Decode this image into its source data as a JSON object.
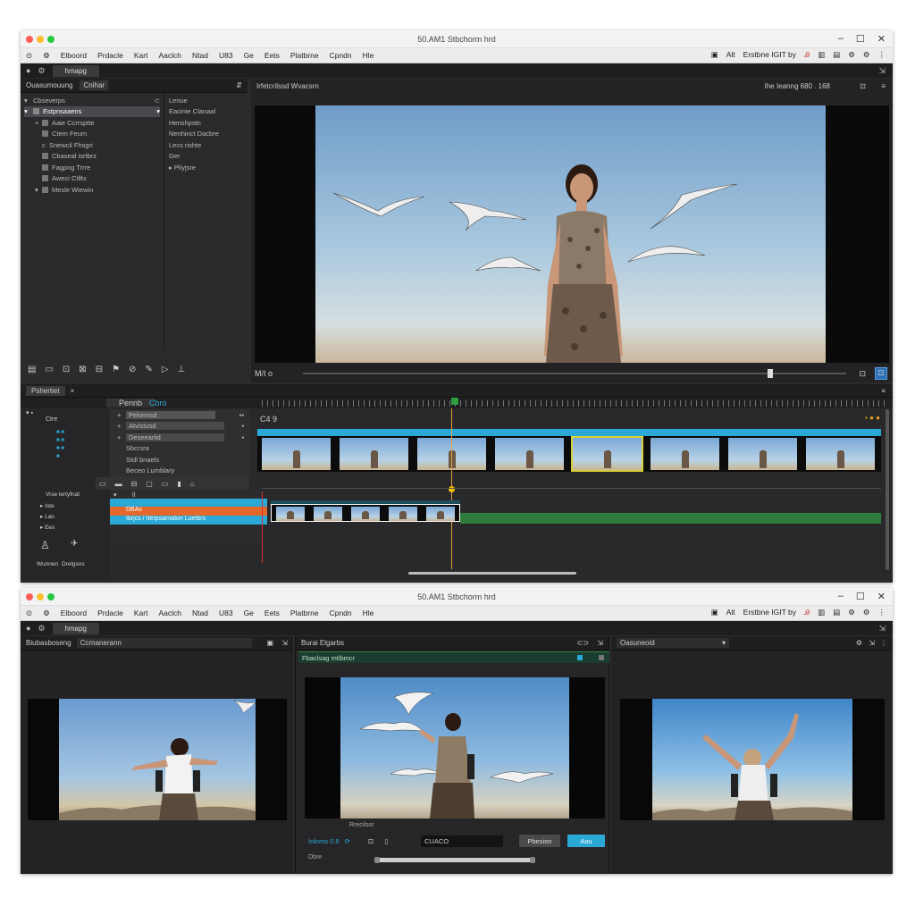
{
  "window1": {
    "title": "50.AM1 Stbchorm hrd",
    "menu": [
      "Elboord",
      "Prdacle",
      "Kart",
      "Aaclch",
      "Ntad",
      "U83",
      "Ge",
      "Eets",
      "Platbrne",
      "Cpndn",
      "Hle"
    ],
    "menu_right": [
      "Alt",
      "Erstbne IGIT by",
      "Ri"
    ],
    "tab": "hmapg",
    "project_panel": {
      "header_left": "Ouasumouung",
      "header_mid": "Cnihar",
      "items": [
        {
          "label": "Cbseverps",
          "selected": false
        },
        {
          "label": "Estpnsaaens",
          "selected": true
        },
        {
          "label": "Aaie Ccrrsptte",
          "selected": false
        },
        {
          "label": "Ctem Feum",
          "selected": false
        },
        {
          "label": "Snewcil Fhsgri",
          "selected": false
        },
        {
          "label": "Cbaseal isrtbrz",
          "selected": false
        },
        {
          "label": "Fagpng Trrre",
          "selected": false
        },
        {
          "label": "Aweci Ctlltx",
          "selected": false
        },
        {
          "label": "Mesle Wiewin",
          "selected": false
        }
      ],
      "col2": [
        "Lenue",
        "Eacinie Clanaal",
        "Henshpstn",
        "Nenhinct Dacbre",
        "Lecs rishte",
        "Ger",
        "Pliyjsre"
      ]
    },
    "viewer": {
      "title": "Irfetcrilssd Wvacsrn",
      "resolution": "Ihe Ieanng 680 . 168",
      "toolbar_left": "M/I o"
    },
    "timeline": {
      "tab": "Pshertiet",
      "ruler_left": "Pennb",
      "ruler_mid": "Cbro",
      "track_label": "C4 9",
      "timecode": "Ctre",
      "tracks_top": [
        "Pelonnsd",
        "Atvistusd",
        "Deseearlid",
        "Sbcrsra",
        "Stdl bnaels",
        "Beceo Lumblary"
      ],
      "tracks_bottom_labels": [
        "Vrse lertyfnat",
        "Iste",
        "Lan",
        "Eex"
      ],
      "orange_clip": "DBAs",
      "blue_clip": "Ibrjcs / Iterpsarnaton Luetbrs",
      "tools_label": [
        "Wunnen",
        "Drelgsns"
      ],
      "pct": "Dd"
    }
  },
  "window2": {
    "title": "50.AM1 Stbchorm hrd",
    "menu": [
      "Elboord",
      "Prdacle",
      "Kart",
      "Aaclch",
      "Ntad",
      "U83",
      "Ge",
      "Eets",
      "Platbrne",
      "Cpndn",
      "Hle"
    ],
    "menu_right": [
      "Alt",
      "Erstbne IGIT by",
      "Ri"
    ],
    "tab": "hmapg",
    "left_panel": {
      "title": "Biubasboseng",
      "search": "Ccrnanerann"
    },
    "mid_panel": {
      "title": "Burai Elgarbs",
      "bar": "Fbaclsag mtlbmcr",
      "caption": "Rrecilsor",
      "time_label": "Inloms 0.8",
      "field": "CUACO",
      "btn_cancel": "Pbesion",
      "btn_ok": "Aou",
      "footer": "Dbre"
    },
    "right_panel": {
      "title": "Oasuneoid"
    }
  },
  "colors": {
    "accent": "#2aa9d6",
    "orange": "#e2692b",
    "green": "#2e7d3c",
    "selection": "#d8d13a"
  }
}
